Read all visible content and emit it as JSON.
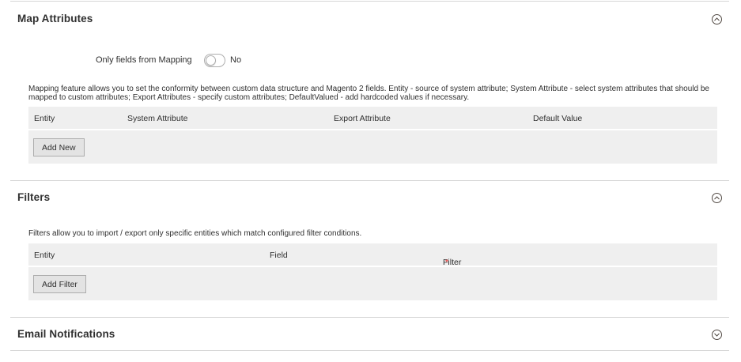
{
  "map_attributes": {
    "title": "Map Attributes",
    "collapse_icon": "chevron-up-circle-icon",
    "only_fields_label": "Only fields from Mapping",
    "only_fields_value": "No",
    "only_fields_enabled": false,
    "note": "Mapping feature allows you to set the conformity between custom data structure and Magento 2 fields. Entity - source of system attribute; System Attribute - select system attributes that should be mapped to custom attributes; Export Attributes - specify custom attributes; DefaultValued - add hardcoded values if necessary.",
    "columns": [
      "Entity",
      "System Attribute",
      "Export Attribute",
      "Default Value"
    ],
    "add_button": "Add New"
  },
  "filters": {
    "title": "Filters",
    "collapse_icon": "chevron-up-circle-icon",
    "note": "Filters allow you to import / export only specific entities which match configured filter conditions.",
    "columns": [
      "Entity",
      "Field",
      "Filter"
    ],
    "required_marker": "*",
    "add_button": "Add Filter"
  },
  "email_notifications": {
    "title": "Email Notifications",
    "collapse_icon": "chevron-down-circle-icon"
  },
  "colors": {
    "text": "#303030",
    "grid_bg": "#efefef",
    "divider": "#d6d6d6",
    "required": "#e22626"
  }
}
